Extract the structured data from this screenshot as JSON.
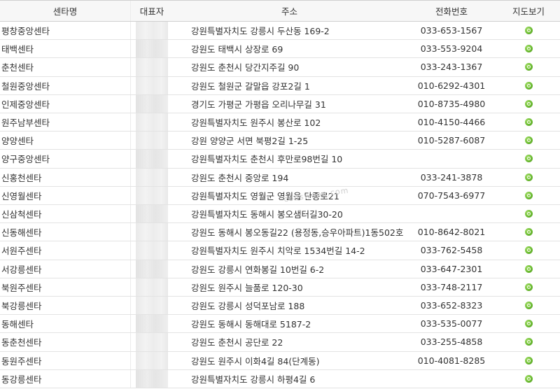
{
  "table": {
    "headers": {
      "name": "센타명",
      "representative": "대표자",
      "address": "주소",
      "phone": "전화번호",
      "map": "지도보기"
    },
    "rows": [
      {
        "name": "평창중앙센타",
        "address": "강원특별자치도 강릉시 두산동 169-2",
        "phone": "033-653-1567"
      },
      {
        "name": "태백센타",
        "address": "강원도 태백시 상장로 69",
        "phone": "033-553-9204"
      },
      {
        "name": "춘천센타",
        "address": "강원도 춘천시 당간지주길 90",
        "phone": "033-243-1367"
      },
      {
        "name": "철원중앙센타",
        "address": "강원도 철원군 갈말읍 강포2길 1",
        "phone": "010-6292-4301"
      },
      {
        "name": "인제중앙센타",
        "address": "경기도 가평군 가평읍 오리나무길 31",
        "phone": "010-8735-4980"
      },
      {
        "name": "원주남부센타",
        "address": "강원특별자치도 원주시 봉산로 102",
        "phone": "010-4150-4466"
      },
      {
        "name": "양양센타",
        "address": "강원 양양군 서면 북평2길 1-25",
        "phone": "010-5287-6087"
      },
      {
        "name": "양구중앙센타",
        "address": "강원특별자치도 춘천시 후만로98번길 10",
        "phone": ""
      },
      {
        "name": "신홍천센타",
        "address": "강원도 춘천시 중앙로 194",
        "phone": "033-241-3878"
      },
      {
        "name": "신영월센타",
        "address": "강원특별자치도 영월군 영월읍 단종로21",
        "phone": "070-7543-6977"
      },
      {
        "name": "신삼척센타",
        "address": "강원특별자치도 동해시 봉오샘터길30-20",
        "phone": ""
      },
      {
        "name": "신동해센타",
        "address": "강원도 동해시 봉오동길22 (용정동,승우아파트)1동502호",
        "phone": "010-8642-8021"
      },
      {
        "name": "서원주센타",
        "address": "강원특별자치도 원주시 치악로 1534번길 14-2",
        "phone": "033-762-5458"
      },
      {
        "name": "서강릉센타",
        "address": "강원도 강릉시 연화봉길 10번길 6-2",
        "phone": "033-647-2301"
      },
      {
        "name": "북원주센타",
        "address": "강원도 원주시 늘품로 120-30",
        "phone": "033-748-2117"
      },
      {
        "name": "북강릉센타",
        "address": "강원도 강릉시 성덕포남로 188",
        "phone": "033-652-8323"
      },
      {
        "name": "동해센타",
        "address": "강원도 동해시 동해대로 5187-2",
        "phone": "033-535-0077"
      },
      {
        "name": "동춘천센타",
        "address": "강원도 춘천시 공단로 22",
        "phone": "033-255-4858"
      },
      {
        "name": "동원주센타",
        "address": "강원도 원주시 이화4길 84(단계동)",
        "phone": "010-4081-8285"
      },
      {
        "name": "동강릉센타",
        "address": "강원특별자치도 강릉시 하평4길 6",
        "phone": ""
      }
    ]
  },
  "watermark": "cooswoon.com",
  "icons": {
    "map": "map-marker-icon"
  },
  "colors": {
    "map_icon": "#6cbc32",
    "header_bg": "#f7f7f7",
    "text": "#333333"
  }
}
